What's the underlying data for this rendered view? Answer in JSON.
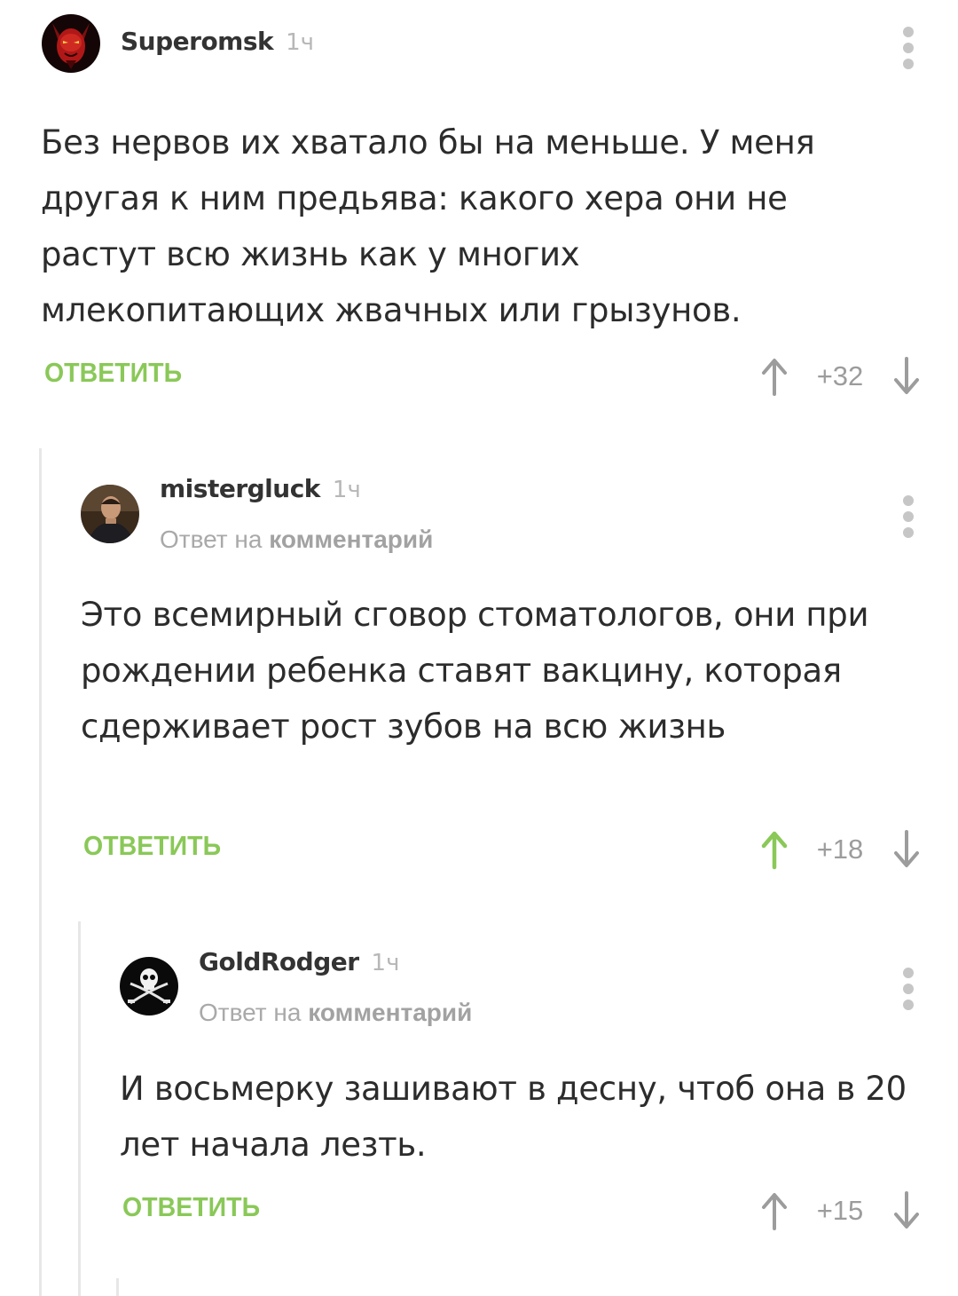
{
  "comments": [
    {
      "username": "Superomsk",
      "time": "1ч",
      "text": "Без нервов их хватало бы на меньше. У меня другая к ним предьява: какого хера они не растут всю жизнь как у многих млекопитающих жвачных или грызунов.",
      "reply_label": "ОТВЕТИТЬ",
      "score": "+32",
      "upvoted": false,
      "avatar_icon": "devil-avatar-icon"
    },
    {
      "username": "mistergluck",
      "time": "1ч",
      "reply_prefix": "Ответ на",
      "reply_target": "комментарий",
      "text": "Это всемирный сговор стоматологов, они при рождении ребенка ставят вакцину, которая сдерживает рост зубов на всю жизнь",
      "reply_label": "ОТВЕТИТЬ",
      "score": "+18",
      "upvoted": true,
      "avatar_icon": "man-photo-avatar-icon"
    },
    {
      "username": "GoldRodger",
      "time": "1ч",
      "reply_prefix": "Ответ на",
      "reply_target": "комментарий",
      "text": "И восьмерку зашивают в десну, чтоб она в 20 лет начала лезть.",
      "reply_label": "ОТВЕТИТЬ",
      "score": "+15",
      "upvoted": false,
      "avatar_icon": "jolly-roger-avatar-icon"
    }
  ],
  "colors": {
    "accent_green": "#8ac858",
    "vote_grey": "#9c9c9c",
    "thread_line": "#e7e7e7"
  }
}
